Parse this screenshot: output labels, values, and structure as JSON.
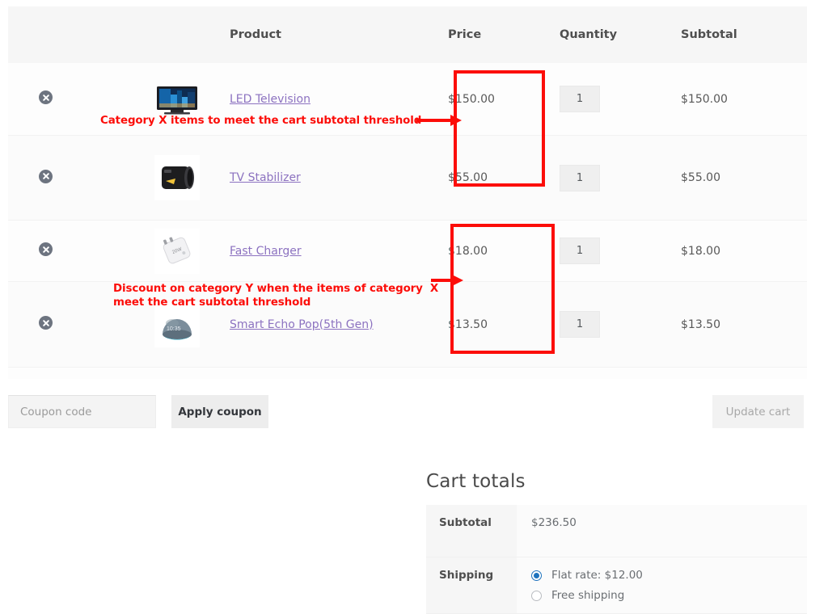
{
  "cart_table": {
    "headers": {
      "remove": "",
      "thumbnail": "",
      "product": "Product",
      "price": "Price",
      "quantity": "Quantity",
      "subtotal": "Subtotal"
    },
    "rows": [
      {
        "remove_label": "×",
        "thumb_name": "led-television-thumbnail",
        "name": "LED Television",
        "price": "$150.00",
        "quantity": "1",
        "subtotal": "$150.00"
      },
      {
        "remove_label": "×",
        "thumb_name": "tv-stabilizer-thumbnail",
        "name": "TV Stabilizer",
        "price": "$55.00",
        "quantity": "1",
        "subtotal": "$55.00"
      },
      {
        "remove_label": "×",
        "thumb_name": "fast-charger-thumbnail",
        "name": "Fast Charger",
        "price": "$18.00",
        "quantity": "1",
        "subtotal": "$18.00"
      },
      {
        "remove_label": "×",
        "thumb_name": "smart-echo-pop-thumbnail",
        "name": "Smart Echo Pop(5th Gen)",
        "price": "$13.50",
        "quantity": "1",
        "subtotal": "$13.50"
      }
    ]
  },
  "actions": {
    "coupon_placeholder": "Coupon code",
    "coupon_value": "",
    "apply_coupon_label": "Apply coupon",
    "update_cart_label": "Update cart"
  },
  "cart_totals": {
    "title": "Cart totals",
    "subtotal_label": "Subtotal",
    "subtotal_value": "$236.50",
    "shipping_label": "Shipping",
    "shipping_options": [
      {
        "label": "Flat rate: $12.00",
        "selected": true
      },
      {
        "label": "Free shipping",
        "selected": false
      }
    ]
  },
  "annotations": {
    "color": "#fc0d09",
    "note_1": "Category X items to meet the cart subtotal threshold",
    "note_2": "Discount on category Y when the items of category  X\nmeet the cart subtotal threshold"
  }
}
